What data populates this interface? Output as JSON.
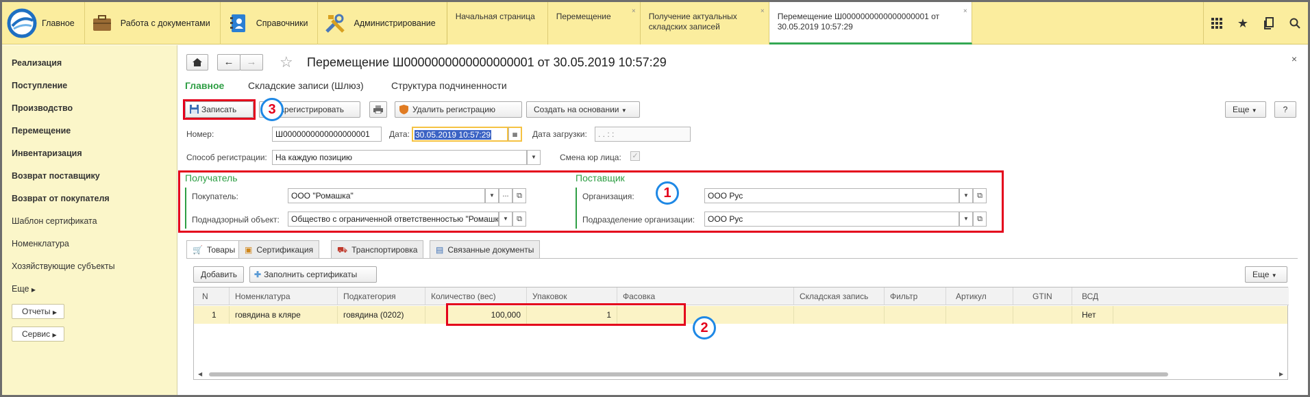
{
  "topbar": {
    "sections": [
      {
        "label": "Главное",
        "icon": "logo-icon"
      },
      {
        "label": "Работа с документами",
        "icon": "briefcase-icon"
      },
      {
        "label": "Справочники",
        "icon": "address-book-icon"
      },
      {
        "label": "Администрирование",
        "icon": "tools-icon"
      }
    ],
    "tabs": [
      {
        "line1": "Начальная страница",
        "line2": ""
      },
      {
        "line1": "Перемещение",
        "line2": ""
      },
      {
        "line1": "Получение актуальных",
        "line2": "складских записей"
      },
      {
        "line1": "Перемещение Ш0000000000000000001 от",
        "line2": "30.05.2019 10:57:29"
      }
    ],
    "close_glyph": "×"
  },
  "sidebar": {
    "items": [
      "Реализация",
      "Поступление",
      "Производство",
      "Перемещение",
      "Инвентаризация",
      "Возврат поставщику",
      "Возврат от покупателя",
      "Шаблон сертификата",
      "Номенклатура",
      "Хозяйствующие субъекты",
      "Еще"
    ],
    "reports": "Отчеты",
    "service": "Сервис"
  },
  "doc": {
    "title": "Перемещение Ш0000000000000000001 от 30.05.2019 10:57:29",
    "subtabs": [
      "Главное",
      "Складские записи (Шлюз)",
      "Структура подчиненности"
    ],
    "toolbar": {
      "save": "Записать",
      "register": "Зарегистрировать",
      "delete_reg": "Удалить регистрацию",
      "create_based": "Создать на основании",
      "more": "Еще",
      "help": "?"
    },
    "fields": {
      "number_label": "Номер:",
      "number_value": "Ш0000000000000000001",
      "date_label": "Дата:",
      "date_value": "30.05.2019 10:57:29",
      "load_date_label": "Дата загрузки:",
      "load_date_value": ". .     : :",
      "reg_method_label": "Способ регистрации:",
      "reg_method_value": "На каждую позицию",
      "change_entity_label": "Смена юр лица:"
    },
    "recipient": {
      "title": "Получатель",
      "buyer_label": "Покупатель:",
      "buyer_value": "ООО \"Ромашка\"",
      "object_label": "Поднадзорный объект:",
      "object_value": "Общество с ограниченной ответственностью   \"Ромашка\""
    },
    "supplier": {
      "title": "Поставщик",
      "org_label": "Организация:",
      "org_value": "ООО Рус",
      "dept_label": "Подразделение организации:",
      "dept_value": "ООО Рус"
    },
    "pagetabs": [
      "Товары",
      "Сертификация",
      "Транспортировка",
      "Связанные документы"
    ],
    "table_toolbar": {
      "add": "Добавить",
      "fill": "Заполнить сертификаты",
      "more": "Еще"
    },
    "table": {
      "headers": [
        "N",
        "Номенклатура",
        "Подкатегория",
        "Количество (вес)",
        "Упаковок",
        "Фасовка",
        "Складская запись",
        "Фильтр",
        "Артикул",
        "GTIN",
        "ВСД"
      ],
      "rows": [
        [
          "1",
          "говядина в кляре",
          "говядина (0202)",
          "100,000",
          "1",
          "",
          "",
          "",
          "",
          "",
          "Нет"
        ]
      ]
    }
  },
  "annotations": {
    "b1": "1",
    "b2": "2",
    "b3": "3"
  },
  "colors": {
    "accent_green": "#2e9e44",
    "highlight_red": "#e4001b",
    "badge_blue": "#1e88e5",
    "topbar_yellow": "#fbed9e"
  }
}
